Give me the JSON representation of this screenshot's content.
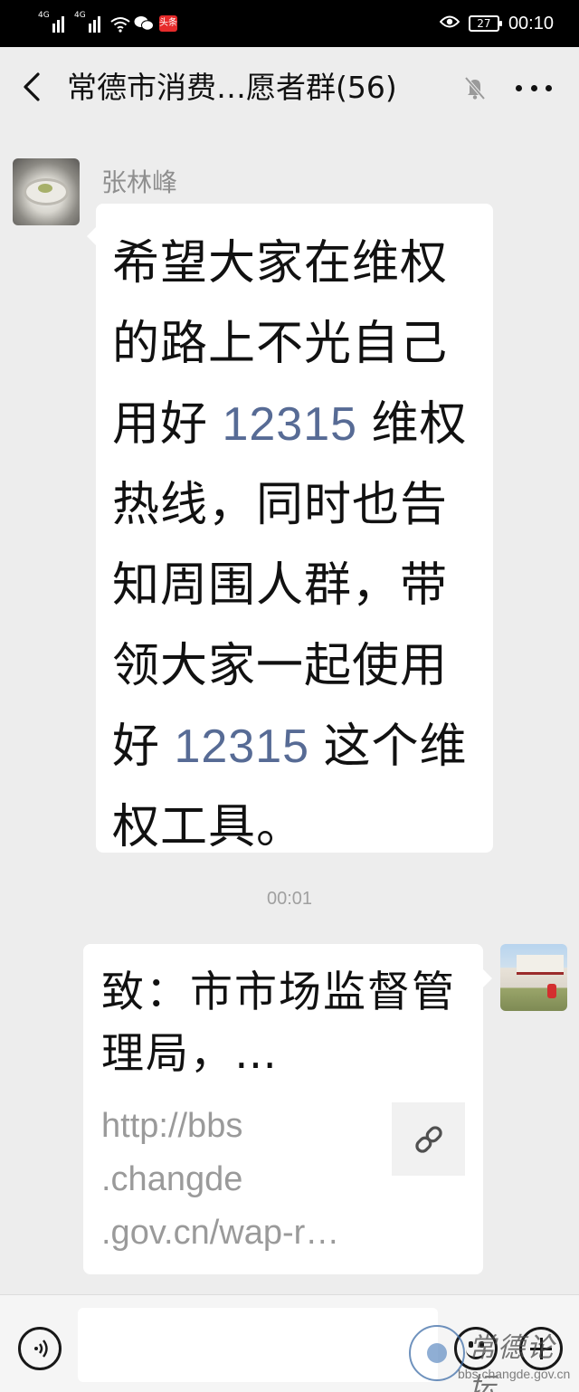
{
  "status_bar": {
    "network_1": "4G",
    "network_2": "4G",
    "toutiao_label": "头条",
    "battery": "27",
    "time": "00:10"
  },
  "header": {
    "title": "常德市消费…愿者群(56)"
  },
  "messages": [
    {
      "sender": "张林峰",
      "segments": [
        {
          "text": "希望大家在维权的路上不光自己用好",
          "link": false
        },
        {
          "text": " 12315 ",
          "link": true
        },
        {
          "text": "维权热线，同时也告知周围人群，带领大家一起使用好",
          "link": false
        },
        {
          "text": " 12315 ",
          "link": true
        },
        {
          "text": "这个维权工具。",
          "link": false
        }
      ]
    }
  ],
  "timestamp": "00:01",
  "link_card": {
    "title": "致：市市场监督管理局，…",
    "url_line_1": "http://bbs",
    "url_line_2": ".changde",
    "url_line_3": ".gov.cn/wap-r…"
  },
  "watermark": {
    "text": "常德论坛",
    "url": "bbs.changde.gov.cn"
  },
  "icons": {
    "back": "chevron-left-icon",
    "mute": "bell-off-icon",
    "more": "more-dots-icon",
    "link": "link-icon",
    "voice": "voice-icon",
    "emoji": "emoji-icon",
    "plus": "plus-icon"
  },
  "colors": {
    "background": "#ededed",
    "bubble": "#ffffff",
    "link_number": "#576b95",
    "sender_name": "#8f8f8f"
  }
}
